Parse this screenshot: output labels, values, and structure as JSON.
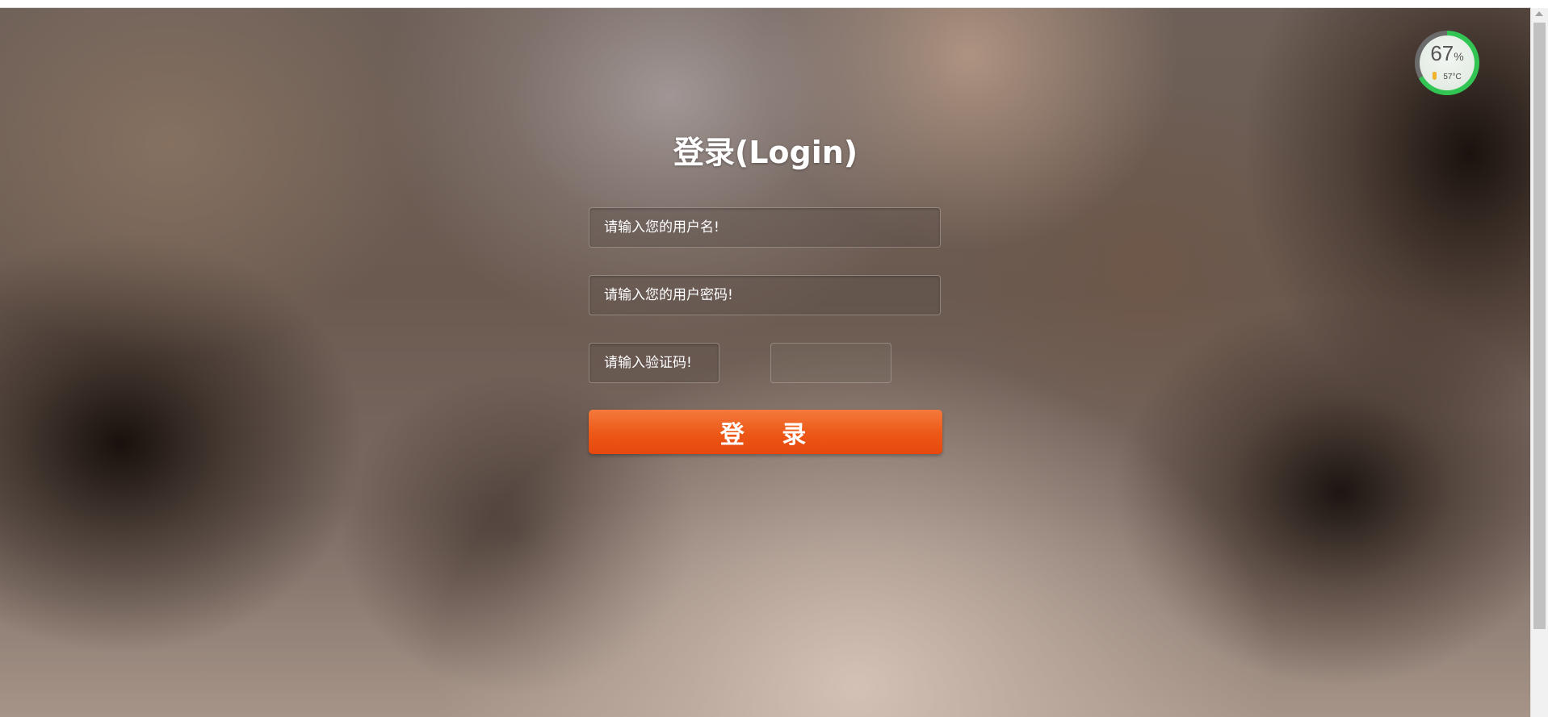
{
  "system_widget": {
    "usage_value": "67",
    "usage_unit": "%",
    "usage_percent": 67,
    "temperature": "57°C",
    "ring_color": "#32c553",
    "icon": "thermometer-icon"
  },
  "login": {
    "title": "登录(Login)",
    "username_placeholder": "请输入您的用户名!",
    "password_placeholder": "请输入您的用户密码!",
    "captcha_placeholder": "请输入验证码!",
    "submit_label": "登 录",
    "button_color": "#ec5716"
  }
}
